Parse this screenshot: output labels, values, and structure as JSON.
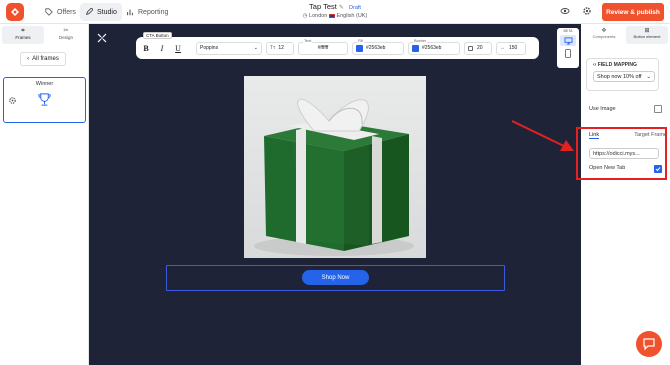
{
  "header": {
    "nav": [
      {
        "label": "Offers",
        "icon": "tag-icon"
      },
      {
        "label": "Studio",
        "icon": "edit-icon"
      },
      {
        "label": "Reporting",
        "icon": "bar-chart-icon"
      }
    ],
    "title": "Tap Test",
    "status": "Draft",
    "location": "London",
    "language": "English (UK)",
    "publish_label": "Review & publish"
  },
  "left_panel": {
    "tabs": [
      {
        "label": "Frames",
        "icon": "frames-icon"
      },
      {
        "label": "Design",
        "icon": "design-icon"
      }
    ],
    "all_frames_label": "All frames",
    "frame": {
      "title": "Winner",
      "icon": "trophy-icon"
    }
  },
  "toolbar": {
    "tag": "CTA Button",
    "font": "Poppins",
    "font_size": "12",
    "text_label": "Text",
    "text_color": "#ffffff",
    "fill_label": "Fill",
    "fill_color": "#2563eb",
    "border_label": "Border",
    "border_color": "#2563eb",
    "radius": "20",
    "width": "150"
  },
  "device": {
    "beta_label": "BETA"
  },
  "canvas": {
    "button_label": "Shop Now"
  },
  "right_panel": {
    "tabs": [
      {
        "label": "Components",
        "icon": "components-icon"
      },
      {
        "label": "Button element",
        "icon": "button-icon"
      }
    ],
    "field_mapping_title": "FIELD MAPPING",
    "field_mapping_value": "Shop now 10% off",
    "use_image_label": "Use Image",
    "link_tab": "Link",
    "target_tab": "Target Frame",
    "link_value": "https://odicci.mys...",
    "open_new_tab_label": "Open New Tab",
    "open_new_tab_checked": true
  },
  "colors": {
    "accent": "#f0522e",
    "primary": "#2563eb",
    "canvas": "#1f2337",
    "highlight": "#e32121"
  }
}
